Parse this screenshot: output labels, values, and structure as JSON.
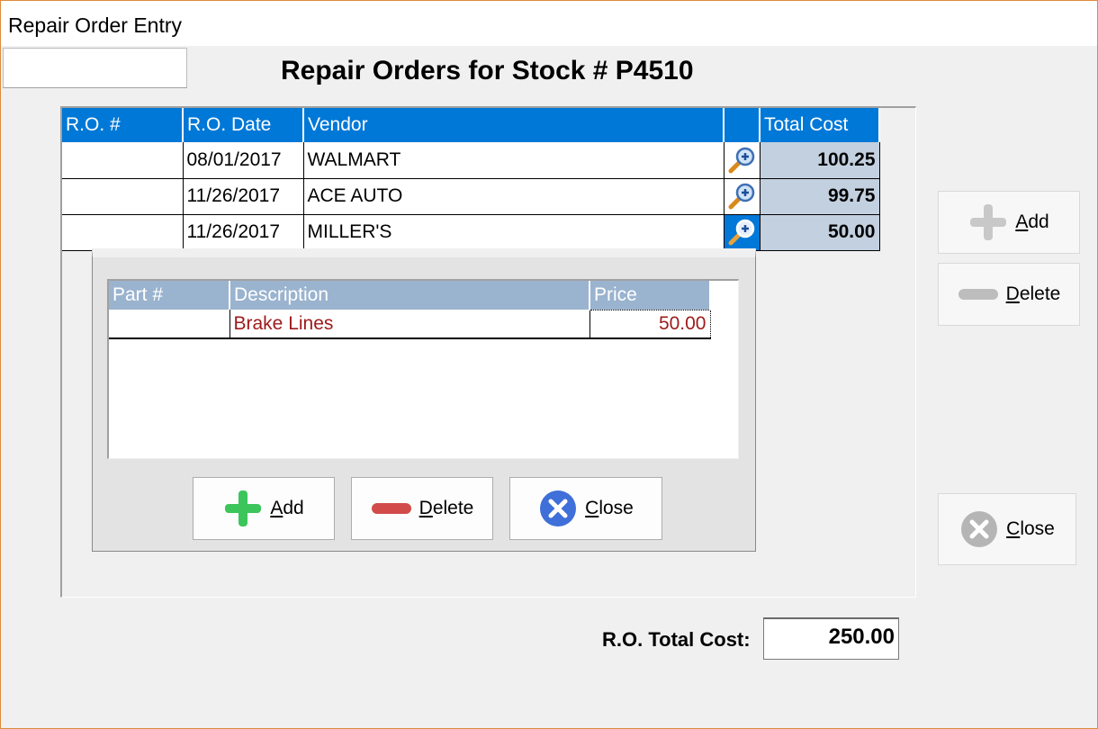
{
  "window": {
    "title": "Repair Order Entry"
  },
  "heading": "Repair Orders for Stock # P4510",
  "ro_grid": {
    "columns": [
      "R.O. #",
      "R.O. Date",
      "Vendor",
      "",
      "Total Cost"
    ],
    "rows": [
      {
        "ro_number": "",
        "date": "08/01/2017",
        "vendor": "WALMART",
        "total_cost": "100.25"
      },
      {
        "ro_number": "",
        "date": "11/26/2017",
        "vendor": "ACE AUTO",
        "total_cost": "99.75"
      },
      {
        "ro_number": "",
        "date": "11/26/2017",
        "vendor": "MILLER'S",
        "total_cost": "50.00"
      }
    ],
    "detail_icon": "magnifier-plus-icon",
    "selected_row": 2
  },
  "parts_grid": {
    "columns": [
      "Part #",
      "Description",
      "Price"
    ],
    "rows": [
      {
        "part_number": "",
        "description": "Brake Lines",
        "price": "50.00"
      }
    ]
  },
  "parts_buttons": {
    "add": {
      "prefix": "",
      "accel": "A",
      "rest": "dd",
      "icon": "plus-icon"
    },
    "delete": {
      "prefix": "",
      "accel": "D",
      "rest": "elete",
      "icon": "minus-icon"
    },
    "close": {
      "prefix": "",
      "accel": "C",
      "rest": "lose",
      "icon": "close-circle-icon"
    }
  },
  "side_buttons": {
    "add": {
      "accel": "A",
      "rest": "dd",
      "icon": "plus-icon",
      "enabled": false
    },
    "delete": {
      "accel": "D",
      "rest": "elete",
      "icon": "minus-icon",
      "enabled": false
    },
    "close": {
      "accel": "C",
      "rest": "lose",
      "icon": "close-circle-icon",
      "enabled": false
    }
  },
  "totals": {
    "label": "R.O. Total Cost:",
    "value": "250.00"
  },
  "colors": {
    "header_blue": "#0078d7",
    "subheader_blue": "#9ab3cf",
    "cost_cell": "#c3d0e0",
    "part_text": "#9e1a1a",
    "add_green": "#3cc55a",
    "delete_red": "#d24b4b",
    "close_blue": "#3f6fd8",
    "window_border": "#e08a3a"
  }
}
